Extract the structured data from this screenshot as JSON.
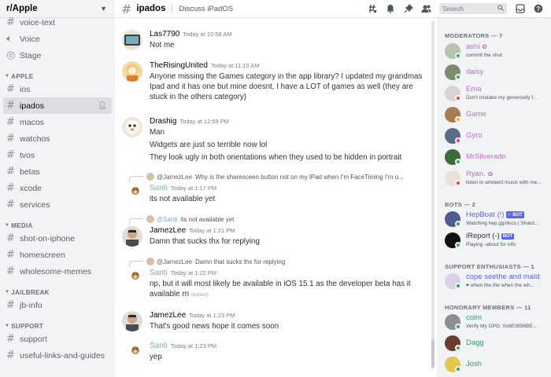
{
  "server": {
    "name": "r/Apple"
  },
  "sidebar": {
    "top_items": [
      {
        "label": "voice-text",
        "kind": "text"
      },
      {
        "label": "Voice",
        "kind": "voice"
      },
      {
        "label": "Stage",
        "kind": "stage"
      }
    ],
    "categories": [
      {
        "name": "APPLE",
        "items": [
          "ios",
          "ipados",
          "macos",
          "watchos",
          "tvos",
          "betas",
          "xcode",
          "services"
        ]
      },
      {
        "name": "MEDIA",
        "items": [
          "shot-on-iphone",
          "homescreen",
          "wholesome-memes"
        ]
      },
      {
        "name": "JAILBREAK",
        "items": [
          "jb-info"
        ]
      },
      {
        "name": "SUPPORT",
        "items": [
          "support",
          "useful-links-and-guides"
        ]
      }
    ],
    "active": "ipados"
  },
  "header": {
    "channel": "ipados",
    "topic": "Discuss iPadOS",
    "search_placeholder": "Search"
  },
  "messages": [
    {
      "author": "Las7790",
      "time": "Today at 10:58 AM",
      "lines": [
        "Not me"
      ]
    },
    {
      "author": "TheRisingUnited",
      "time": "Today at 11:10 AM",
      "lines": [
        "Anyone missing the Games category in the app library? I updated my grandmas Ipad and it has one but mine doesnt, I have a LOT of games as well (they are stuck in the others category)"
      ]
    },
    {
      "author": "Drashig",
      "time": "Today at 12:59 PM",
      "lines": [
        "Man",
        "Widgets are just so terrible now lol",
        "They look ugly in both orientations when they used to be hidden in portrait"
      ]
    },
    {
      "reply_to": "@JamezLee",
      "reply_text": "Why is the sharesceen button not on my iPad when I'm FaceTiming I'm o...",
      "author": "Santi",
      "time": "Today at 1:17 PM",
      "lines": [
        "its not available yet"
      ]
    },
    {
      "reply_to": "@Santi",
      "reply_text": "its not available yet",
      "author": "JamezLee",
      "time": "Today at 1:21 PM",
      "lines": [
        "Damn that sucks thx for replying"
      ]
    },
    {
      "reply_to": "@JamezLee",
      "reply_text": "Damn that sucks thx for replying",
      "author": "Santi",
      "time": "Today at 1:22 PM",
      "lines": [
        "np, but it will most likely be available in iOS 15.1 as the developer beta has it available rn"
      ],
      "edited": "(edited)"
    },
    {
      "author": "JamezLee",
      "time": "Today at 1:23 PM",
      "lines": [
        "That's good news hope it comes soon"
      ]
    },
    {
      "author": "Santi",
      "time": "Today at 1:23 PM",
      "lines": [
        "yep"
      ]
    }
  ],
  "members": {
    "moderators_label": "MODERATORS — 7",
    "moderators": [
      {
        "name": "ashi",
        "status": "commit the shut",
        "color": "#c16bd6",
        "badge": "✿"
      },
      {
        "name": "daisy",
        "status": "",
        "color": "#c16bd6"
      },
      {
        "name": "Ema",
        "status": "Don't mistake my generosity f...",
        "color": "#c16bd6"
      },
      {
        "name": "Game",
        "status": "",
        "color": "#c16bd6"
      },
      {
        "name": "Gyro",
        "status": "",
        "color": "#c16bd6"
      },
      {
        "name": "MrSilverado",
        "status": "",
        "color": "#c16bd6"
      },
      {
        "name": "Ryan.",
        "status": "listen to ambient music with me...",
        "color": "#c16bd6",
        "badge": "✿"
      }
    ],
    "bots_label": "BOTS — 2",
    "bots": [
      {
        "name": "HepBoat (!)",
        "status": "Watching hep.gg/docs | Shard...",
        "color": "#5865f2",
        "tag": "✓ BOT"
      },
      {
        "name": "iReport (-)",
        "status": "Playing -about for info",
        "color": "#2e3338",
        "tag": "BOT"
      }
    ],
    "enthusiasts_label": "SUPPORT ENTHUSIASTS — 1",
    "enthusiasts": [
      {
        "name": "cope seethe and mald",
        "status": "♥ when the the when the wh...",
        "color": "#5865f2"
      }
    ],
    "honorary_label": "HONORARY MEMBERS — 11",
    "honorary": [
      {
        "name": "colm",
        "status": "Verify My GPG: 0x8E0856BE...",
        "color": "#2e9c6e"
      },
      {
        "name": "Dagg",
        "status": "",
        "color": "#2e9c6e"
      },
      {
        "name": "Josh",
        "status": "",
        "color": "#2e9c6e"
      }
    ]
  },
  "colors": {
    "online": "#3ba55c",
    "dnd": "#ed4245",
    "idle": "#faa81a"
  }
}
